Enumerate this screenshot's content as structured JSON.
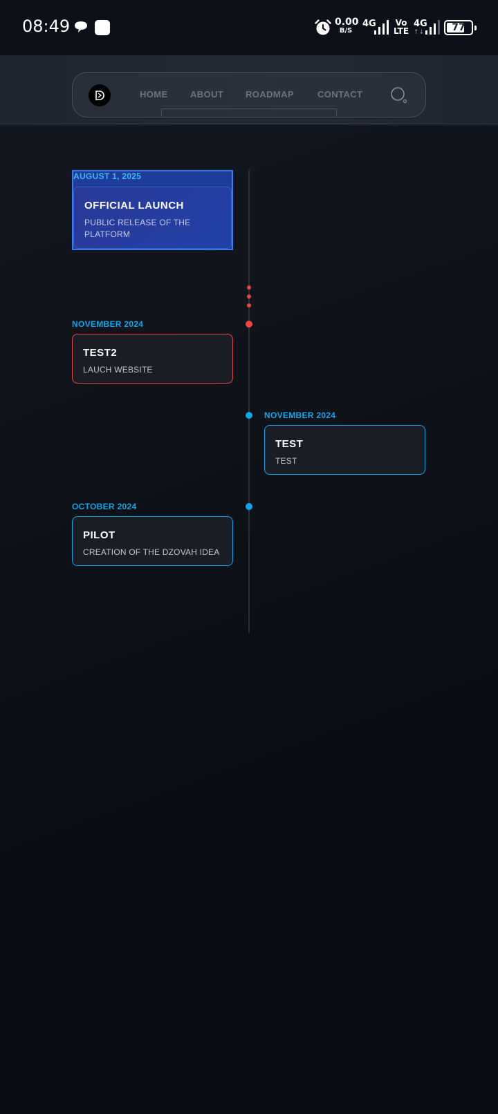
{
  "status_bar": {
    "time": "08:49",
    "net_speed_value": "0.00",
    "net_speed_unit": "B/S",
    "network_1": "4G",
    "volte_top": "Vo",
    "volte_bottom": "LTE",
    "network_2": "4G",
    "data_arrows": "↑↓",
    "battery_level": "77",
    "battery_fraction": 0.77,
    "icons": [
      "chat-bubble-icon",
      "app-square-icon",
      "alarm-icon",
      "signal-icon",
      "battery-icon"
    ]
  },
  "nav": {
    "links": [
      "HOME",
      "ABOUT",
      "ROADMAP",
      "CONTACT"
    ],
    "logo_icon": "dzovah-logo-icon",
    "search_icon": "search-icon"
  },
  "timeline": {
    "entries": [
      {
        "date": "AUGUST 1, 2025",
        "title": "OFFICIAL LAUNCH",
        "description": "PUBLIC RELEASE OF THE PLATFORM",
        "side": "left",
        "state": "selected"
      },
      {
        "date": "NOVEMBER 2024",
        "title": "TEST2",
        "description": "LAUCH WEBSITE",
        "side": "left",
        "state": "red"
      },
      {
        "date": "NOVEMBER 2024",
        "title": "TEST",
        "description": "TEST",
        "side": "right",
        "state": "blue"
      },
      {
        "date": "OCTOBER 2024",
        "title": "PILOT",
        "description": "CREATION OF THE DZOVAH IDEA",
        "side": "left",
        "state": "blue"
      }
    ]
  },
  "colors": {
    "accent_blue": "#0ea5e9",
    "accent_red": "#ef4444",
    "selected_bg": "#1e3c9a",
    "background": "#0b0e15"
  }
}
